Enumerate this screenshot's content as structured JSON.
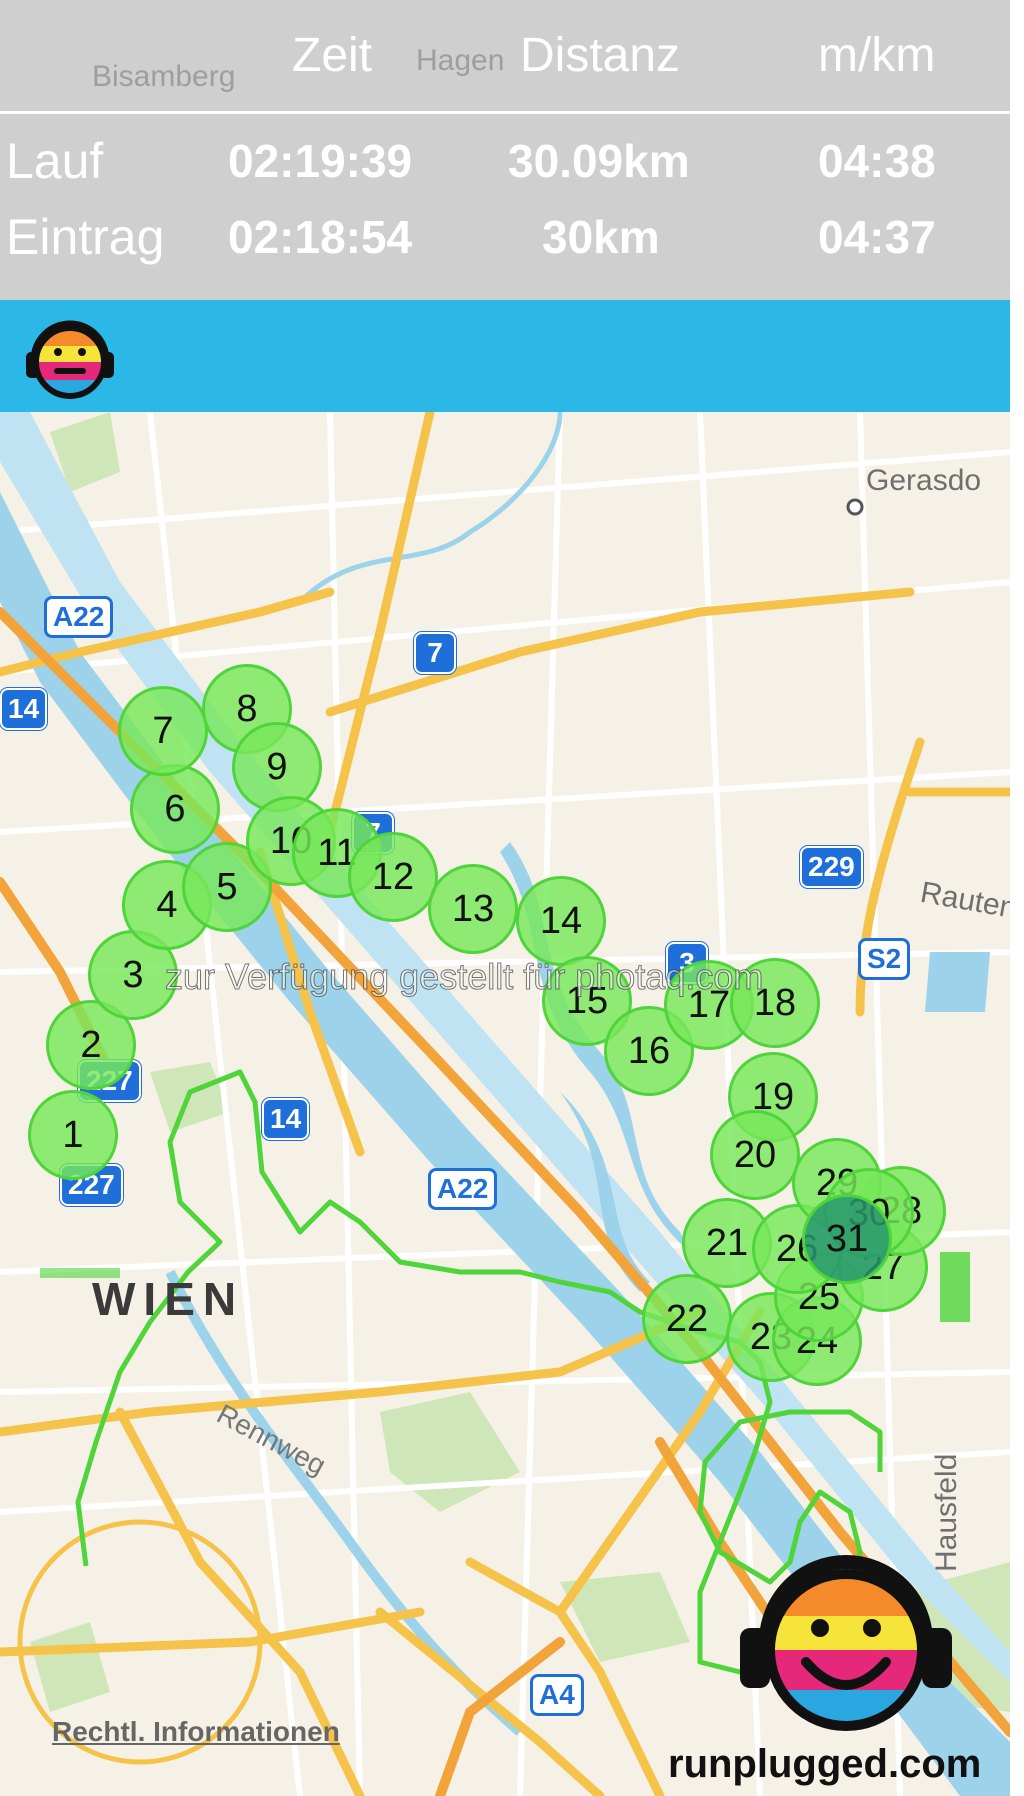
{
  "header": {
    "columns": [
      "Zeit",
      "Distanz",
      "m/km"
    ],
    "rows": [
      {
        "label": "Lauf",
        "time": "02:19:39",
        "distance": "30.09km",
        "pace": "04:38"
      },
      {
        "label": "Eintrag",
        "time": "02:18:54",
        "distance": "30km",
        "pace": "04:37"
      }
    ],
    "background_places": [
      "Bisamberg",
      "Hagen"
    ]
  },
  "app_bar": {
    "icon": "runplugged-face-icon",
    "color": "#2bb8e6"
  },
  "map": {
    "places": [
      "Gerasdo",
      "Rauten",
      "Hausfeld",
      "WIEN",
      "Rennweg"
    ],
    "road_shields": [
      "A22",
      "7",
      "14",
      "229",
      "S2",
      "227",
      "14",
      "A22",
      "227",
      "A4",
      "3",
      "7"
    ],
    "km_markers": [
      "1",
      "2",
      "3",
      "4",
      "5",
      "6",
      "7",
      "8",
      "9",
      "10",
      "11",
      "12",
      "13",
      "14",
      "15",
      "16",
      "17",
      "18",
      "19",
      "20",
      "21",
      "22",
      "23",
      "24",
      "25",
      "26",
      "27",
      "28",
      "29",
      "30",
      "31"
    ],
    "route_color": "#4fd43a",
    "legal_link": "Rechtl. Informationen",
    "watermark": "zur Verfügung gestellt für photaq.com",
    "brand": "runplugged.com"
  }
}
